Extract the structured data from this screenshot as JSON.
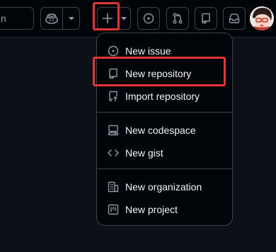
{
  "header": {
    "search_partial_text": "n",
    "buttons": {
      "copilot": "copilot-icon",
      "create": "plus-icon",
      "issues": "issue-opened-icon",
      "pulls": "git-pull-request-icon",
      "repos": "repo-icon",
      "inbox": "inbox-icon"
    }
  },
  "create_menu": {
    "items": [
      {
        "label": "New issue",
        "icon": "issue-opened-icon"
      },
      {
        "label": "New repository",
        "icon": "repo-icon"
      },
      {
        "label": "Import repository",
        "icon": "repo-push-icon"
      },
      {
        "label": "New codespace",
        "icon": "codespaces-icon"
      },
      {
        "label": "New gist",
        "icon": "code-icon"
      },
      {
        "label": "New organization",
        "icon": "organization-icon"
      },
      {
        "label": "New project",
        "icon": "project-icon"
      }
    ]
  },
  "colors": {
    "highlight": "#e03636",
    "header_bg": "#010409",
    "menu_border": "#3d444d",
    "text": "#f0f6fc",
    "muted_icon": "#9198a1"
  }
}
